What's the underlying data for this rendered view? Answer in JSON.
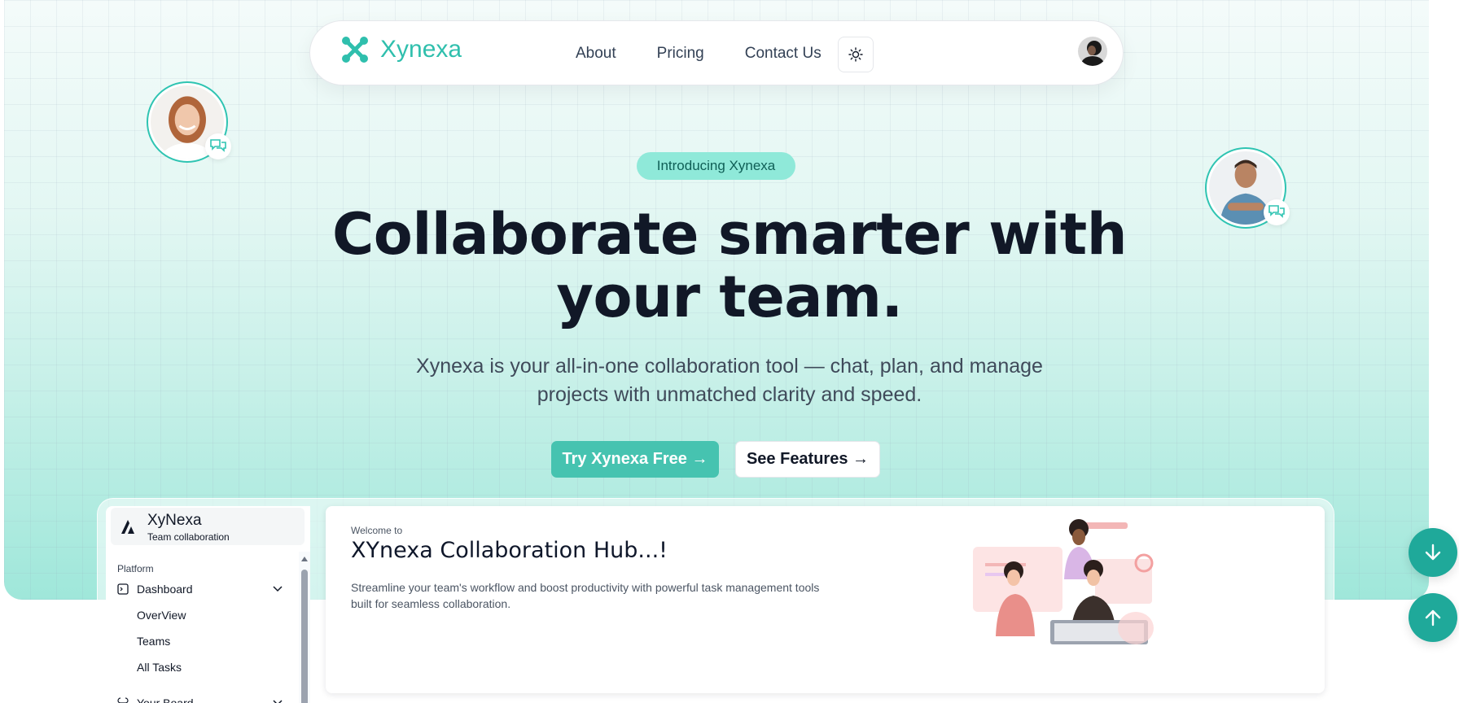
{
  "brand": {
    "name": "Xynexa",
    "accent": "#2fbfad"
  },
  "nav": {
    "links": [
      "About",
      "Pricing",
      "Contact Us"
    ],
    "theme_icon": "sun-icon",
    "avatar_icon": "user-avatar"
  },
  "hero": {
    "badge": "Introducing Xynexa",
    "headline_line1": "Collaborate smarter with",
    "headline_line2": "your team.",
    "sub_line1": "Xynexa is your all-in-one collaboration tool — chat, plan, and manage",
    "sub_line2": "projects with unmatched clarity and speed.",
    "cta_primary": "Try Xynexa Free →",
    "cta_secondary": "See Features →",
    "primary_color": "#46c3b0"
  },
  "sidebar": {
    "title": "XyNexa",
    "subtitle": "Team collaboration",
    "section": "Platform",
    "items": [
      {
        "label": "Dashboard",
        "icon": "dashboard-icon"
      },
      {
        "label": "Your Board",
        "icon": "command-icon"
      }
    ],
    "sub_items": [
      "OverView",
      "Teams",
      "All Tasks"
    ]
  },
  "main": {
    "welcome": "Welcome to",
    "title": "XYnexa Collaboration Hub...!",
    "desc_line1": "Streamline your team's workflow and boost productivity with powerful task management tools",
    "desc_line2": "built for seamless collaboration."
  },
  "fabs": {
    "down_icon": "arrow-down-icon",
    "up_icon": "arrow-up-icon",
    "color": "#1fa99a"
  }
}
